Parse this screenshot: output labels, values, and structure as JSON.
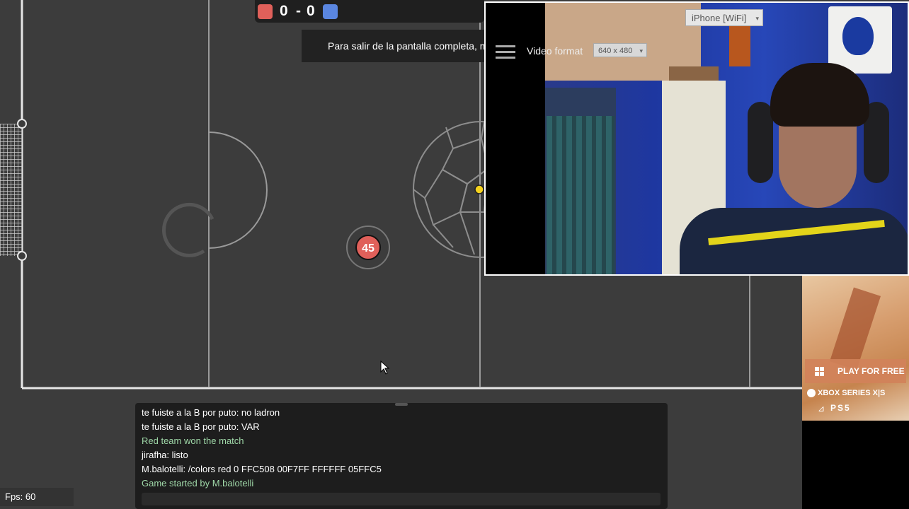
{
  "scoreboard": {
    "red_score": "0",
    "separator": "-",
    "blue_score": "0",
    "red_color": "#e0605a",
    "blue_color": "#5a86e0"
  },
  "fullscreen_message": "Para salir de la pantalla completa, m",
  "player": {
    "number": "45",
    "color": "#e0605a"
  },
  "webcam": {
    "device": "iPhone [WiFi]",
    "video_format_label": "Video format",
    "video_format_value": "640 x 480"
  },
  "ad": {
    "play_label": "PLAY FOR FREE",
    "xbox_label": "XBOX SERIES X|S",
    "ps_label": "PS5"
  },
  "chat": {
    "lines": [
      {
        "text": "te fuiste a la B por puto: no ladron",
        "type": "user"
      },
      {
        "text": "te fuiste a la B por puto: VAR",
        "type": "user"
      },
      {
        "text": "Red team won the match",
        "type": "system"
      },
      {
        "text": "jirafha: listo",
        "type": "user"
      },
      {
        "text": "M.balotelli: /colors red 0 FFC508 00F7FF FFFFFF 05FFC5",
        "type": "user"
      },
      {
        "text": "Game started by M.balotelli",
        "type": "system"
      }
    ]
  },
  "fps": "Fps: 60",
  "colors": {
    "field": "#3c3c3c",
    "lines": "#c8c8c8",
    "goal_post": "#e6e6e6",
    "ball_marker": "#f5d21e"
  }
}
